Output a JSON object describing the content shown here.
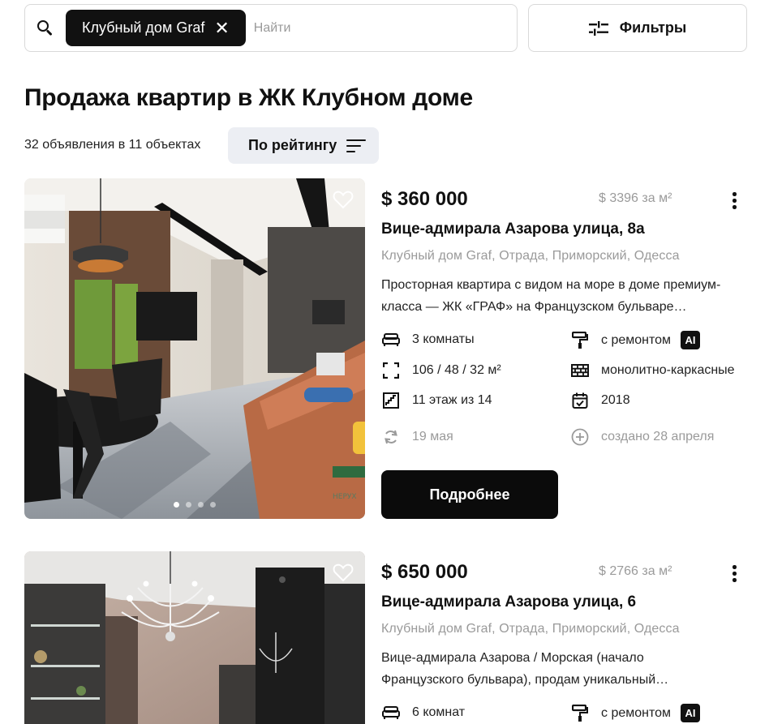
{
  "search": {
    "chip_label": "Клубный дом Graf",
    "placeholder": "Найти",
    "value": ""
  },
  "filters_label": "Фильтры",
  "page_title": "Продажа квартир в ЖК Клубном доме",
  "listing_count": "32 объявления в 11 объектах",
  "sort_label": "По рейтингу",
  "listings": [
    {
      "price": "$ 360 000",
      "price_per_m2": "$ 3396 за м²",
      "address": "Вице-адмирала Азарова улица, 8а",
      "location": "Клубный дом Graf, Отрада, Приморский, Одесса",
      "description_line1": "Просторная квартира с видом на море в доме премиум-",
      "description_line2": "класса — ЖК «ГРАФ» на Французском бульваре…",
      "rooms": "3 комнаты",
      "area": "106 / 48 / 32 м²",
      "floor": "11 этаж из 14",
      "condition": "с ремонтом",
      "ai_badge": "AI",
      "construction": "монолитно-каркасные",
      "year": "2018",
      "updated": "19 мая",
      "created": "создано 28 апреля",
      "details_label": "Подробнее",
      "photo_overlay": "НЕРУХ"
    },
    {
      "price": "$ 650 000",
      "price_per_m2": "$ 2766 за м²",
      "address": "Вице-адмирала Азарова улица, 6",
      "location": "Клубный дом Graf, Отрада, Приморский, Одесса",
      "description_line1": "Вице-адмирала Азарова / Морская (начало",
      "description_line2": "Французского бульвара), продам уникальный…",
      "rooms": "6 комнат",
      "condition": "с ремонтом",
      "ai_badge": "AI"
    }
  ],
  "colors": {
    "primary": "#111111",
    "muted_text": "#9a9a9a",
    "border": "#d9d9d9",
    "sort_bg": "#eceef3"
  }
}
